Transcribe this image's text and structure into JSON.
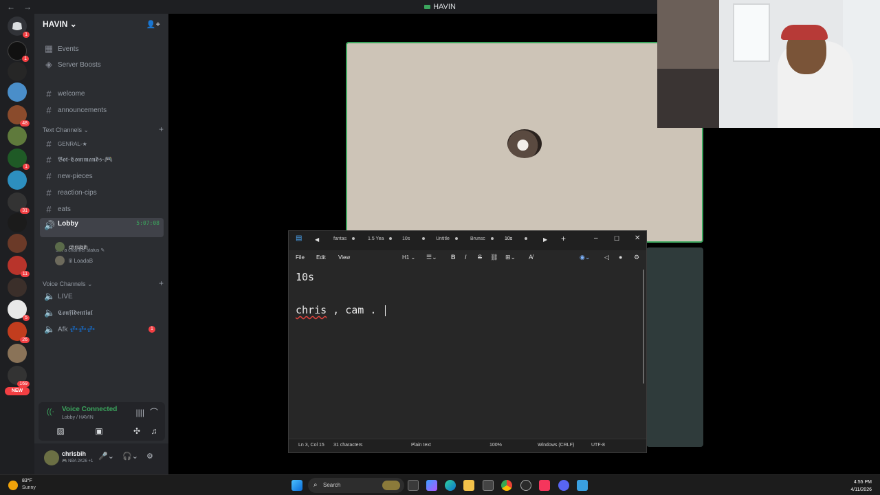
{
  "topbar": {
    "back": "←",
    "forward": "→",
    "server_title": "HAVIN"
  },
  "rail": {
    "badges": [
      "1",
      "1",
      "48",
      "1",
      "31",
      "11",
      "5",
      "26",
      "169"
    ],
    "new_label": "NEW"
  },
  "sidebar": {
    "server_name": "HAVIN ⌄",
    "items": [
      {
        "icon": "▦",
        "label": "Events"
      },
      {
        "icon": "◈",
        "label": "Server Boosts"
      },
      {
        "icon": "#",
        "label": "welcome"
      },
      {
        "icon": "#",
        "label": "announcements"
      }
    ],
    "text_category": "Text Channels ⌄",
    "text_channels": [
      "GENRAL-★",
      "𝕭𝖔𝖙-𝕮𝖔𝖒𝖒𝖆𝖓𝖉𝖘-🎮",
      "new-pieces",
      "reaction-cips",
      "eats"
    ],
    "lobby": {
      "label": "Lobby",
      "time": "5:07:08",
      "status": "Set a channel status ✎"
    },
    "voice_users": [
      "chrisbih",
      "lil LoadaB"
    ],
    "voice_category": "Voice Channels ⌄",
    "voice_channels": [
      "LIVE",
      "𝕮𝖔𝖓𝖋𝖎𝖉𝖊𝖓𝖙𝖎𝖆𝖑",
      "Afk 💤💤💤"
    ],
    "afk_badge": "1",
    "plus": "+"
  },
  "voice_panel": {
    "title": "Voice Connected",
    "subtitle": "Lobby / HAVIN"
  },
  "user_panel": {
    "name": "chrisbih",
    "status": "🎮 NBA 2K26 +1"
  },
  "notepad": {
    "tabs": [
      "fantas",
      "1.5 Yea",
      "10s",
      "Untitle",
      "Brunsc",
      "10s"
    ],
    "new_tab": "+",
    "menu": {
      "file": "File",
      "edit": "Edit",
      "view": "View"
    },
    "heading_tool": "H1",
    "content": {
      "line1": "10s",
      "line3_word": "chris",
      "line3_rest": " , cam . "
    },
    "status": {
      "position": "Ln 3, Col 15",
      "chars": "31 characters",
      "format": "Plain text",
      "zoom": "100%",
      "line_ending": "Windows (CRLF)",
      "encoding": "UTF-8"
    }
  },
  "taskbar": {
    "temp": "83°F",
    "condition": "Sunny",
    "search": "Search",
    "time": "4:55 PM",
    "date": "4/11/2026"
  }
}
